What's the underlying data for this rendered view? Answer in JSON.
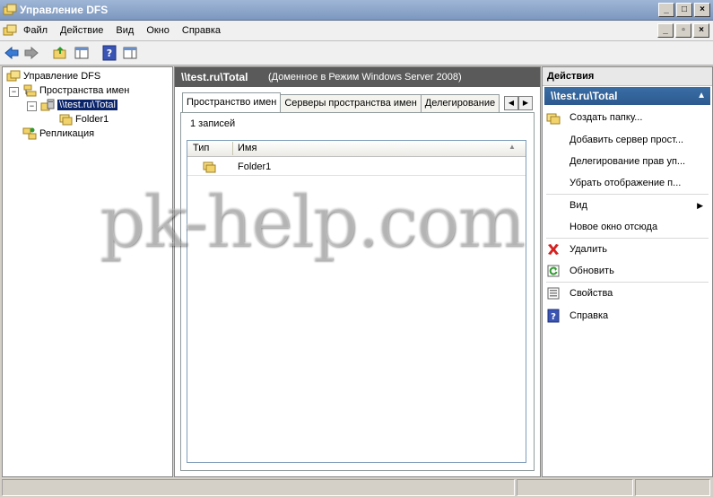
{
  "window": {
    "title": "Управление DFS",
    "controls": [
      "_",
      "□",
      "×"
    ]
  },
  "menu": {
    "items": [
      "Файл",
      "Действие",
      "Вид",
      "Окно",
      "Справка"
    ],
    "mdi_controls": [
      "_",
      "▫",
      "×"
    ]
  },
  "tree": {
    "root": "Управление DFS",
    "namespaces": "Пространства имен",
    "namespace": "\\\\test.ru\\Total",
    "folder": "Folder1",
    "replication": "Репликация"
  },
  "center": {
    "path": "\\\\test.ru\\Total",
    "description": "(Доменное в Режим Windows Server 2008)",
    "tabs": [
      "Пространство имен",
      "Серверы пространства имен",
      "Делегирование"
    ],
    "records": "1 записей",
    "columns": [
      "Тип",
      "Имя"
    ],
    "rows": [
      {
        "name": "Folder1"
      }
    ]
  },
  "actions": {
    "header": "Действия",
    "section": "\\\\test.ru\\Total",
    "items": [
      "Создать папку...",
      "Добавить сервер прост...",
      "Делегирование прав уп...",
      "Убрать отображение п...",
      "Вид",
      "Новое окно отсюда",
      "Удалить",
      "Обновить",
      "Свойства",
      "Справка"
    ]
  },
  "watermark": "pk-help.com",
  "colors": {
    "selection": "#0a246a",
    "action_header": "#3a6ea5",
    "delete_red": "#d62020"
  }
}
